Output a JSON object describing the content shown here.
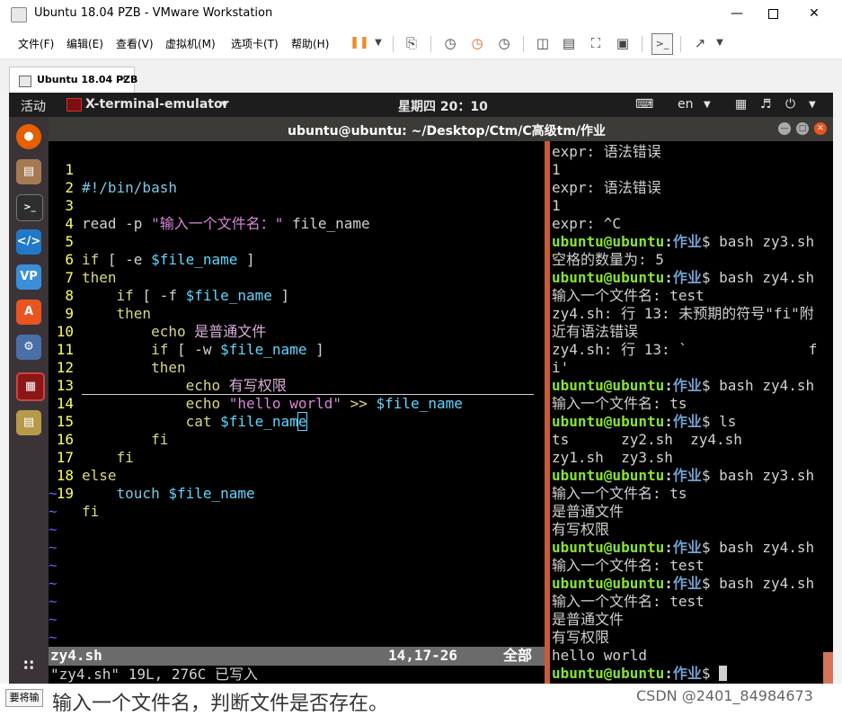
{
  "window": {
    "title": "Ubuntu 18.04 PZB - VMware Workstation"
  },
  "menu": {
    "items": [
      "文件(F)",
      "编辑(E)",
      "查看(V)",
      "虚拟机(M)",
      "选项卡(T)",
      "帮助(H)"
    ]
  },
  "toolbar": {
    "pause_glyph": "❚❚",
    "icons": [
      "send-keys-icon",
      "snapshot-icon",
      "revert-snapshot-icon",
      "snapshot-manager-icon",
      "full-screen-icon",
      "console-view-icon",
      "unity-icon",
      "stretch-icon"
    ]
  },
  "tab": {
    "label": "Ubuntu 18.04 PZB"
  },
  "gnome": {
    "activities": "活动",
    "app": "X-terminal-emulator",
    "clock": "星期四 20：10",
    "lang": "en"
  },
  "terminal": {
    "title": "ubuntu@ubuntu: ~/Desktop/Ctm/C高级tm/作业"
  },
  "vim": {
    "tilde": "~",
    "lines": {
      "n1": "1",
      "t1": "#!/bin/bash",
      "n2": "2",
      "n3": "3",
      "t3a": "read -p ",
      "t3b": "\"输入一个文件名：\"",
      "t3c": " file_name",
      "n4": "4",
      "n5": "5",
      "t5a": "if",
      "t5b": " [ -e ",
      "t5c": "$file_name",
      "t5d": " ]",
      "n6": "6",
      "t6": "then",
      "n7": "7",
      "t7a": "    if",
      "t7b": " [ -f ",
      "t7c": "$file_name",
      "t7d": " ]",
      "n8": "8",
      "t8": "    then",
      "n9": "9",
      "t9a": "        echo",
      "t9b": " 是普通文件",
      "n10": "10",
      "t10a": "        if",
      "t10b": " [ -w ",
      "t10c": "$file_name",
      "t10d": " ]",
      "n11": "11",
      "t11": "        then",
      "n12": "12",
      "t12a": "            echo",
      "t12b": " 有写权限",
      "n13": "13",
      "t13a": "            echo",
      "t13b": " \"hello world\"",
      "t13c": " >> ",
      "t13d": "$file_name",
      "n14": "14",
      "t14a": "            cat ",
      "t14b": "$file_nam",
      "t14c": "e",
      "n15": "15",
      "t15": "        fi",
      "n16": "16",
      "t16": "    fi",
      "n17": "17",
      "t17": "else",
      "n18": "18",
      "t18a": "    touch ",
      "t18b": "$file_name",
      "n19": "19",
      "t19": "fi"
    },
    "status": {
      "file": "zy4.sh",
      "position": "14,17-26",
      "scroll": "全部"
    },
    "cmdline": "\"zy4.sh\" 19L, 276C 已写入"
  },
  "shell": {
    "prompt_user": "ubuntu@ubuntu",
    "prompt_colon": ":",
    "prompt_dir": "作业",
    "l1": "expr: 语法错误",
    "l2": "1",
    "l3": "expr: 语法错误",
    "l4": "1",
    "l5": "expr: ^C",
    "c6": "$ bash zy3.sh",
    "l7": "空格的数量为: 5",
    "c8": "$ bash zy4.sh",
    "l9": "输入一个文件名: test",
    "l10": "zy4.sh: 行 13: 未预期的符号\"fi\"附",
    "l11": "近有语法错误",
    "l12": "zy4.sh: 行 13: `              f",
    "l13": "i'",
    "c14": "$ bash zy4.sh",
    "l15": "输入一个文件名: ts",
    "c16": "$ ls",
    "l17": "ts      zy2.sh  zy4.sh",
    "l18": "zy1.sh  zy3.sh",
    "c19": "$ bash zy3.sh",
    "l20": "输入一个文件名: ts",
    "l21": "是普通文件",
    "l22": "有写权限",
    "c23": "$ bash zy4.sh",
    "l24": "输入一个文件名: test",
    "c25": "$ bash zy4.sh",
    "l26": "输入一个文件名: test",
    "l27": "是普通文件",
    "l28": "有写权限",
    "l29": "hello world",
    "c30": "$ "
  },
  "overlay": {
    "subtitle": "输入一个文件名，判断文件是否存在。",
    "watermark": "CSDN @2401_84984673",
    "tooltip": "要将输"
  },
  "colors": {
    "prompt_user": "#8ae234",
    "prompt_dir": "#729fcf",
    "vim_linenumber": "#ffff5f",
    "divider": "#c75b3a"
  }
}
